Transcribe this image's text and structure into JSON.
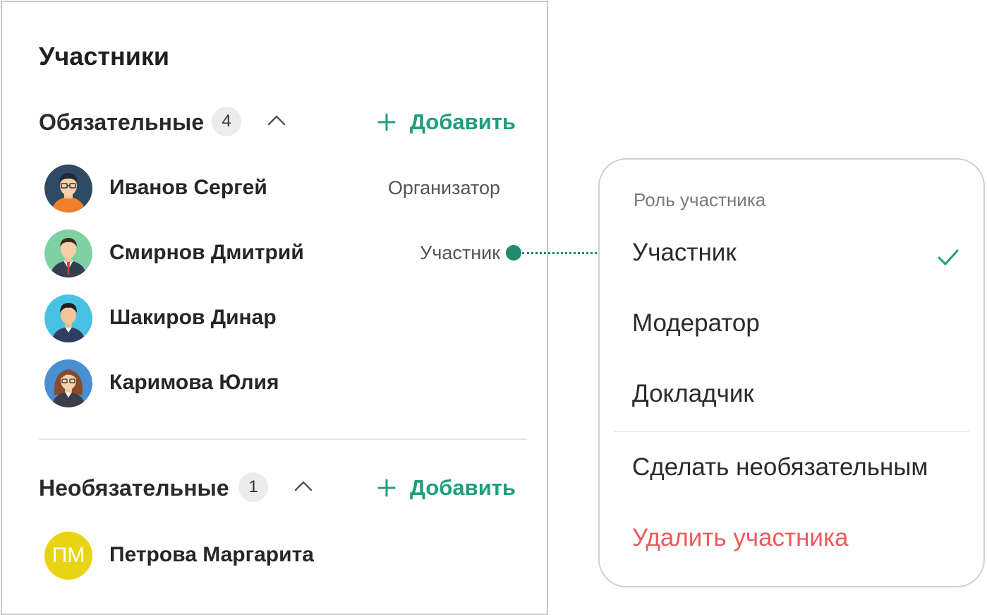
{
  "panel": {
    "title": "Участники"
  },
  "required_group": {
    "title": "Обязательные",
    "count": "4",
    "add_label": "Добавить",
    "members": [
      {
        "name": "Иванов Сергей",
        "role": "Организатор"
      },
      {
        "name": "Смирнов Дмитрий",
        "role": "Участник"
      },
      {
        "name": "Шакиров Динар",
        "role": ""
      },
      {
        "name": "Каримова Юлия",
        "role": ""
      }
    ]
  },
  "optional_group": {
    "title": "Необязательные",
    "count": "1",
    "add_label": "Добавить",
    "members": [
      {
        "name": "Петрова Маргарита",
        "initials": "ПМ"
      }
    ]
  },
  "role_menu": {
    "header": "Роль участника",
    "items": [
      {
        "label": "Участник",
        "selected": true
      },
      {
        "label": "Модератор",
        "selected": false
      },
      {
        "label": "Докладчик",
        "selected": false
      }
    ],
    "make_optional_label": "Сделать необязательным",
    "remove_label": "Удалить участника"
  },
  "colors": {
    "accent": "#1f9e7c",
    "connector": "#1f8a6e",
    "danger": "#ec5b5b",
    "initials_avatar": "#e8d414"
  },
  "icons": {
    "add": "plus-icon",
    "collapse": "chevron-up-icon",
    "selected": "check-icon"
  }
}
